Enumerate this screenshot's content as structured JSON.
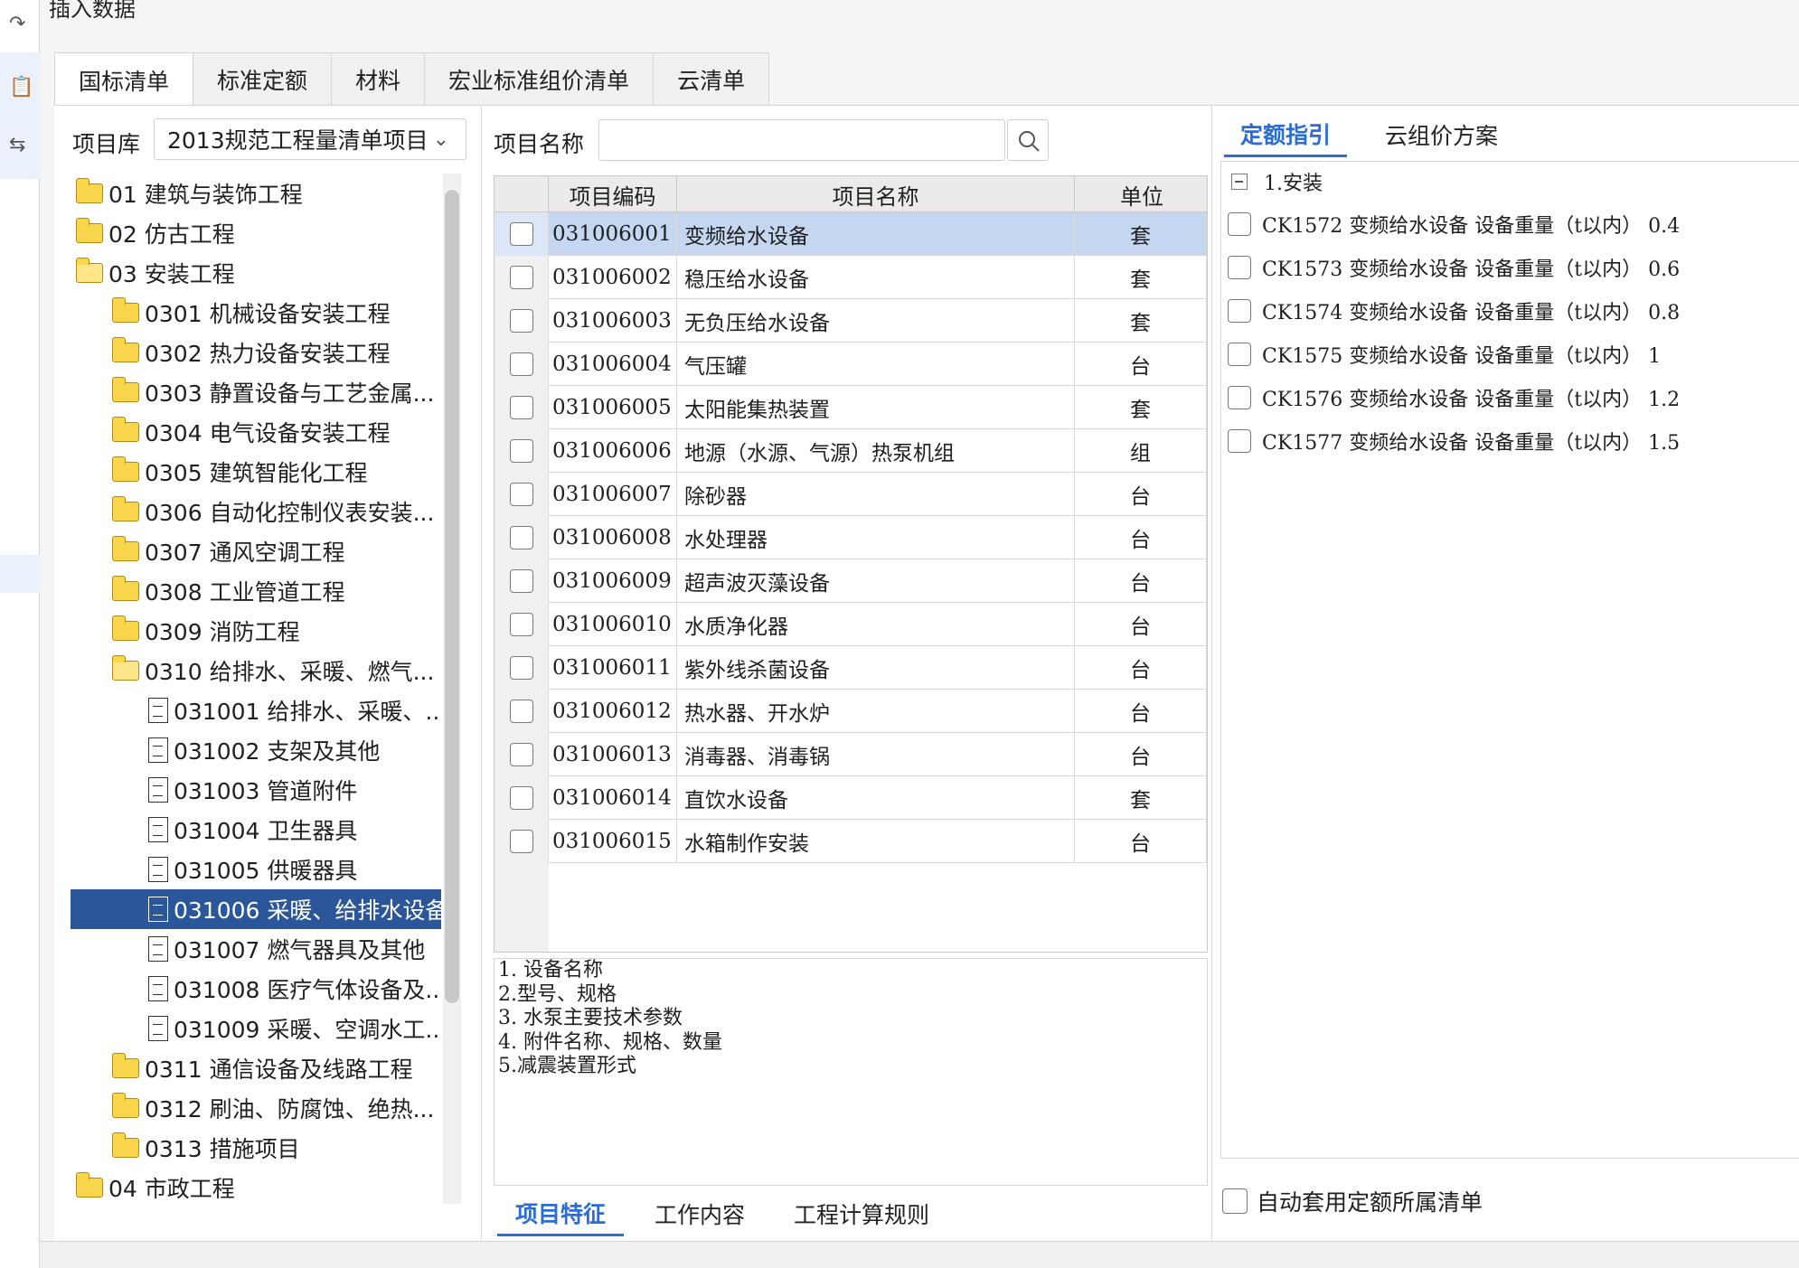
{
  "dialog_title": "插入数据",
  "tabs": [
    "国标清单",
    "标准定额",
    "材料",
    "宏业标准组价清单",
    "云清单"
  ],
  "active_tab": "国标清单",
  "library": {
    "label": "项目库",
    "selected": "2013规范工程量清单项目"
  },
  "tree": [
    {
      "label": "01 建筑与装饰工程",
      "type": "folder",
      "level": 0
    },
    {
      "label": "02 仿古工程",
      "type": "folder",
      "level": 0
    },
    {
      "label": "03 安装工程",
      "type": "folder-open",
      "level": 0
    },
    {
      "label": "0301 机械设备安装工程",
      "type": "folder",
      "level": 1
    },
    {
      "label": "0302 热力设备安装工程",
      "type": "folder",
      "level": 1
    },
    {
      "label": "0303 静置设备与工艺金属...",
      "type": "folder",
      "level": 1
    },
    {
      "label": "0304 电气设备安装工程",
      "type": "folder",
      "level": 1
    },
    {
      "label": "0305 建筑智能化工程",
      "type": "folder",
      "level": 1
    },
    {
      "label": "0306 自动化控制仪表安装...",
      "type": "folder",
      "level": 1
    },
    {
      "label": "0307 通风空调工程",
      "type": "folder",
      "level": 1
    },
    {
      "label": "0308 工业管道工程",
      "type": "folder",
      "level": 1
    },
    {
      "label": "0309 消防工程",
      "type": "folder",
      "level": 1
    },
    {
      "label": "0310 给排水、采暖、燃气...",
      "type": "folder-open",
      "level": 1
    },
    {
      "label": "031001 给排水、采暖、...",
      "type": "doc",
      "level": 2
    },
    {
      "label": "031002 支架及其他",
      "type": "doc",
      "level": 2
    },
    {
      "label": "031003 管道附件",
      "type": "doc",
      "level": 2
    },
    {
      "label": "031004 卫生器具",
      "type": "doc",
      "level": 2
    },
    {
      "label": "031005 供暖器具",
      "type": "doc",
      "level": 2
    },
    {
      "label": "031006 采暖、给排水设备",
      "type": "doc",
      "level": 2,
      "selected": true
    },
    {
      "label": "031007 燃气器具及其他",
      "type": "doc",
      "level": 2
    },
    {
      "label": "031008 医疗气体设备及...",
      "type": "doc",
      "level": 2
    },
    {
      "label": "031009 采暖、空调水工...",
      "type": "doc",
      "level": 2
    },
    {
      "label": "0311 通信设备及线路工程",
      "type": "folder",
      "level": 1
    },
    {
      "label": "0312 刷油、防腐蚀、绝热...",
      "type": "folder",
      "level": 1
    },
    {
      "label": "0313 措施项目",
      "type": "folder",
      "level": 1
    },
    {
      "label": "04 市政工程",
      "type": "folder",
      "level": 0
    }
  ],
  "search": {
    "label": "项目名称",
    "value": "",
    "placeholder": ""
  },
  "grid": {
    "headers": [
      "项目编码",
      "项目名称",
      "单位"
    ],
    "rows": [
      {
        "code": "031006001",
        "name": "变频给水设备",
        "unit": "套",
        "selected": true
      },
      {
        "code": "031006002",
        "name": "稳压给水设备",
        "unit": "套"
      },
      {
        "code": "031006003",
        "name": "无负压给水设备",
        "unit": "套"
      },
      {
        "code": "031006004",
        "name": "气压罐",
        "unit": "台"
      },
      {
        "code": "031006005",
        "name": "太阳能集热装置",
        "unit": "套"
      },
      {
        "code": "031006006",
        "name": "地源（水源、气源）热泵机组",
        "unit": "组"
      },
      {
        "code": "031006007",
        "name": "除砂器",
        "unit": "台"
      },
      {
        "code": "031006008",
        "name": "水处理器",
        "unit": "台"
      },
      {
        "code": "031006009",
        "name": "超声波灭藻设备",
        "unit": "台"
      },
      {
        "code": "031006010",
        "name": "水质净化器",
        "unit": "台"
      },
      {
        "code": "031006011",
        "name": "紫外线杀菌设备",
        "unit": "台"
      },
      {
        "code": "031006012",
        "name": "热水器、开水炉",
        "unit": "台"
      },
      {
        "code": "031006013",
        "name": "消毒器、消毒锅",
        "unit": "台"
      },
      {
        "code": "031006014",
        "name": "直饮水设备",
        "unit": "套"
      },
      {
        "code": "031006015",
        "name": "水箱制作安装",
        "unit": "台"
      }
    ]
  },
  "features": [
    "1. 设备名称",
    "2.型号、规格",
    "3. 水泵主要技术参数",
    "4. 附件名称、规格、数量",
    "5.减震装置形式"
  ],
  "bottom_tabs": [
    "项目特征",
    "工作内容",
    "工程计算规则"
  ],
  "right_tabs": [
    "定额指引",
    "云组价方案"
  ],
  "quota_group": "1.安装",
  "quota_items": [
    "CK1572 变频给水设备 设备重量（t以内） 0.4",
    "CK1573 变频给水设备 设备重量（t以内） 0.6",
    "CK1574 变频给水设备 设备重量（t以内） 0.8",
    "CK1575 变频给水设备 设备重量（t以内） 1",
    "CK1576 变频给水设备 设备重量（t以内） 1.2",
    "CK1577 变频给水设备 设备重量（t以内） 1.5"
  ],
  "auto_apply_label": "自动套用定额所属清单",
  "colors": {
    "accent": "#2b6cd6",
    "tree_selected": "#2b579a",
    "row_selected": "#c5d6f1"
  }
}
